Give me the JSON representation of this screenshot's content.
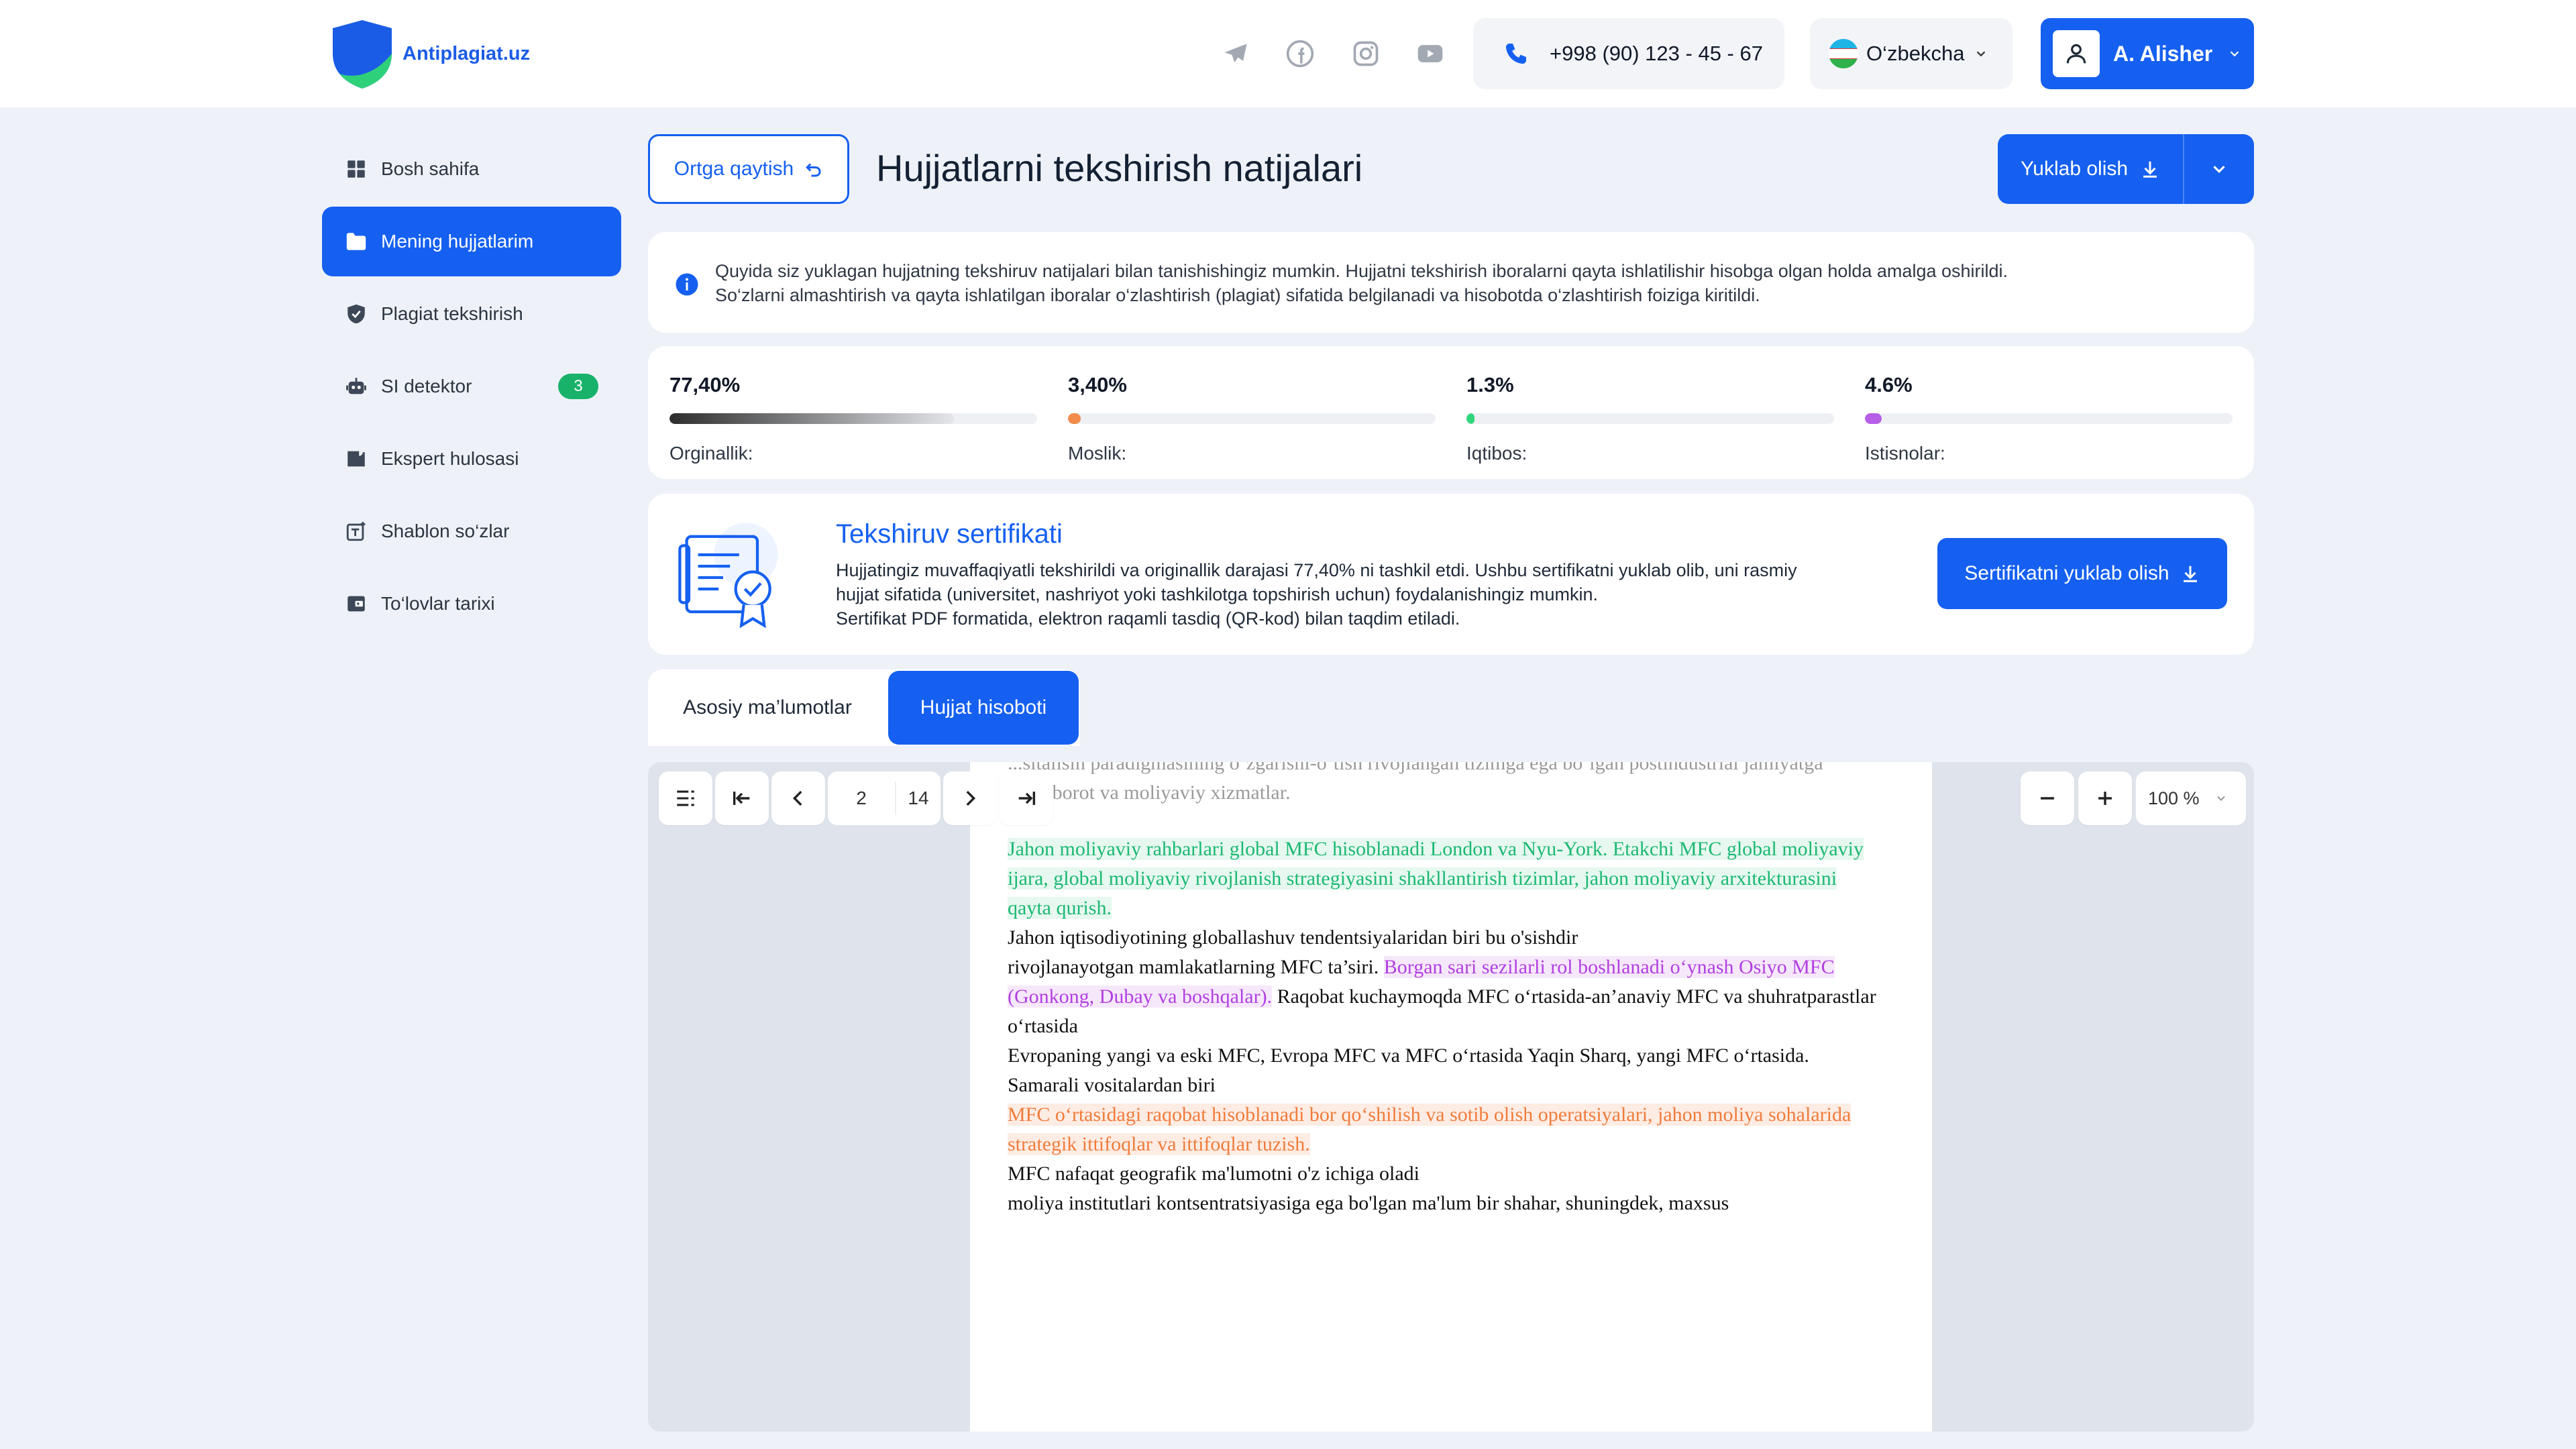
{
  "header": {
    "brand": "Antiplagiat.uz",
    "phone": "+998 (90) 123 - 45 - 67",
    "language": "O‘zbekcha",
    "user": "A. Alisher",
    "social_icons": [
      "telegram-icon",
      "facebook-icon",
      "instagram-icon",
      "youtube-icon"
    ]
  },
  "sidebar": {
    "items": [
      {
        "label": "Bosh sahifa",
        "icon": "grid-icon"
      },
      {
        "label": "Mening hujjatlarim",
        "icon": "folder-icon",
        "active": true
      },
      {
        "label": "Plagiat tekshirish",
        "icon": "shield-check-icon"
      },
      {
        "label": "SI detektor",
        "icon": "robot-icon",
        "badge": "3"
      },
      {
        "label": "Ekspert hulosasi",
        "icon": "expert-icon"
      },
      {
        "label": "Shablon so‘zlar",
        "icon": "template-icon"
      },
      {
        "label": "To‘lovlar tarixi",
        "icon": "wallet-icon"
      }
    ]
  },
  "main": {
    "back_label": "Ortga qaytish",
    "title": "Hujjatlarni tekshirish natijalari",
    "download_label": "Yuklab olish",
    "info_line1": "Quyida siz yuklagan hujjatning tekshiruv natijalari bilan tanishishingiz mumkin. Hujjatni tekshirish iboralarni qayta ishlatilishir hisobga olgan holda amalga oshirildi.",
    "info_line2": "So‘zlarni almashtirish va qayta ishlatilgan iboralar o‘zlashtirish (plagiat) sifatida belgilanadi va hisobotda o‘zlashtirish foiziga kiritildi.",
    "stats": [
      {
        "value": "77,40%",
        "label": "Orginallik:",
        "fraction": 0.774,
        "color": "#2d2d2d"
      },
      {
        "value": "3,40%",
        "label": "Moslik:",
        "fraction": 0.034,
        "color": "#f28a4c"
      },
      {
        "value": "1.3%",
        "label": "Iqtibos:",
        "fraction": 0.013,
        "color": "#31d67b"
      },
      {
        "value": "4.6%",
        "label": "Istisnolar:",
        "fraction": 0.046,
        "color": "#b75ee8"
      }
    ],
    "certificate": {
      "title": "Tekshiruv sertifikati",
      "line1": "Hujjatingiz muvaffaqiyatli tekshirildi va originallik darajasi 77,40% ni tashkil etdi. Ushbu sertifikatni yuklab olib, uni rasmiy",
      "line2": "hujjat sifatida (universitet, nashriyot yoki tashkilotga topshirish uchun) foydalanishingiz mumkin.",
      "line3": "Sertifikat PDF formatida, elektron raqamli tasdiq (QR-kod) bilan taqdim etiladi.",
      "button": "Sertifikatni yuklab olish"
    },
    "tabs": [
      "Asosiy ma’lumotlar",
      "Hujjat hisoboti"
    ]
  },
  "viewer": {
    "current_page": "2",
    "total_pages": "14",
    "zoom": "100 %",
    "doc": {
      "faded1": "...sitalisin paradigmasining o‘zgarishi-o‘tish rivojlangan tizimga ega bo‘lgan postindustrial jamiyatga",
      "faded2": "...t axborot va moliyaviy xizmatlar.",
      "green": "Jahon moliyaviy rahbarlari global MFC hisoblanadi London va Nyu-York. Etakchi MFC global moliyaviy ijara, global moliyaviy rivojlanish strategiyasini shakllantirish tizimlar, jahon moliyaviy arxitekturasini qayta qurish.",
      "p2_line1": "Jahon iqtisodiyotining globallashuv tendentsiyalaridan biri bu o'sishdir",
      "p2_start": "rivojlanayotgan mamlakatlarning MFC ta’siri. ",
      "purple": "Borgan sari sezilarli rol boshlanadi o‘ynash Osiyo MFC (Gonkong, Dubay va boshqalar).",
      "p2_end": " Raqobat kuchaymoqda MFC o‘rtasida-an’anaviy MFC va shuhratparastlar o‘rtasida",
      "p3": "Evropaning yangi va eski MFC, Evropa MFC va MFC o‘rtasida Yaqin Sharq, yangi MFC o‘rtasida.",
      "p4": "Samarali vositalardan biri",
      "orange": "MFC o‘rtasidagi raqobat hisoblanadi bor qo‘shilish va sotib olish operatsiyalari, jahon moliya sohalarida strategik ittifoqlar va ittifoqlar tuzish.",
      "p5": "MFC nafaqat geografik ma'lumotni o'z ichiga oladi",
      "p6": "moliya institutlari kontsentratsiyasiga ega bo'lgan ma'lum bir shahar, shuningdek, maxsus"
    }
  }
}
